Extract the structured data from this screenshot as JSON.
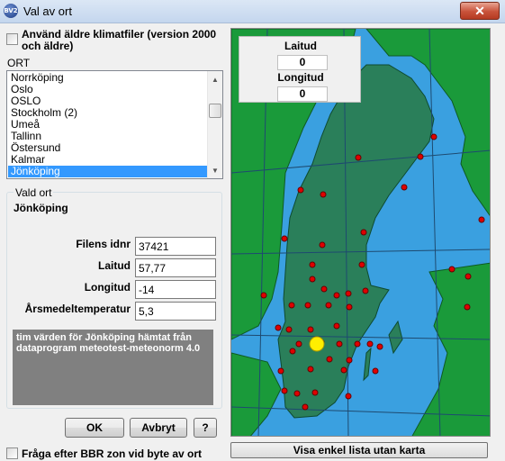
{
  "window": {
    "title": "Val av ort",
    "icon_text": "BV2"
  },
  "old_climate_checkbox": {
    "label_line1": "Använd äldre klimatfiler (version 2000",
    "label_line2": "och äldre)",
    "checked": false
  },
  "list": {
    "label": "ORT",
    "items": [
      "Norrköping",
      "Oslo",
      "OSLO",
      "Stockholm (2)",
      "Umeå",
      "Tallinn",
      "Östersund",
      "Kalmar",
      "Jönköping"
    ],
    "selected": "Jönköping"
  },
  "selected_place": {
    "group_title": "Vald ort",
    "name": "Jönköping",
    "fields": [
      {
        "label": "Filens idnr",
        "value": "37421"
      },
      {
        "label": "Laitud",
        "value": "57,77"
      },
      {
        "label": "Longitud",
        "value": "-14"
      },
      {
        "label": "Årsmedeltemperatur",
        "value": "5,3"
      }
    ],
    "info": "tim värden för Jönköping hämtat från dataprogram meteotest-meteonorm 4.0"
  },
  "buttons": {
    "ok": "OK",
    "cancel": "Avbryt",
    "help": "?"
  },
  "bbr_checkbox": {
    "label": "Fråga efter BBR zon vid byte av ort",
    "checked": false
  },
  "map": {
    "latitude_label": "Laitud",
    "latitude_value": "0",
    "longitude_label": "Longitud",
    "longitude_value": "0",
    "colors": {
      "sea": "#3aa0e0",
      "land": "#1a9a3a",
      "sweden": "#2a7f5a",
      "station": "#e00000",
      "selected": "#ffee00",
      "grid": "#1e4a70"
    }
  },
  "map_button": "Visa enkel lista utan karta"
}
